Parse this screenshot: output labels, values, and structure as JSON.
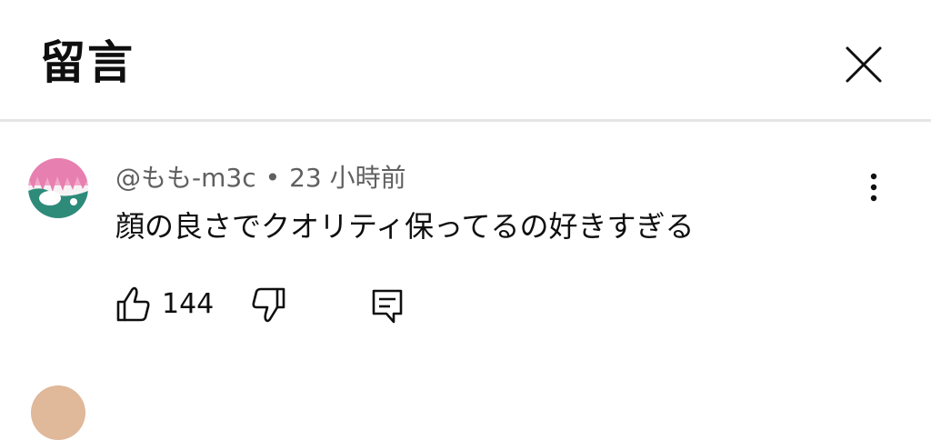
{
  "header": {
    "title": "留言"
  },
  "comment": {
    "author": "@もも-m3c",
    "separator": "•",
    "time": "23 小時前",
    "text": "顔の良さでクオリティ保ってるの好きすぎる",
    "like_count": "144"
  },
  "icons": {
    "close": "close-icon",
    "more": "more-vert-icon",
    "like": "thumb-up-icon",
    "dislike": "thumb-down-icon",
    "reply": "reply-comment-icon"
  },
  "colors": {
    "text_primary": "#0f0f0f",
    "text_secondary": "#606060",
    "divider": "#e5e5e5",
    "avatar_pink": "#f2a6c8",
    "avatar_teal": "#2e8b7a"
  }
}
